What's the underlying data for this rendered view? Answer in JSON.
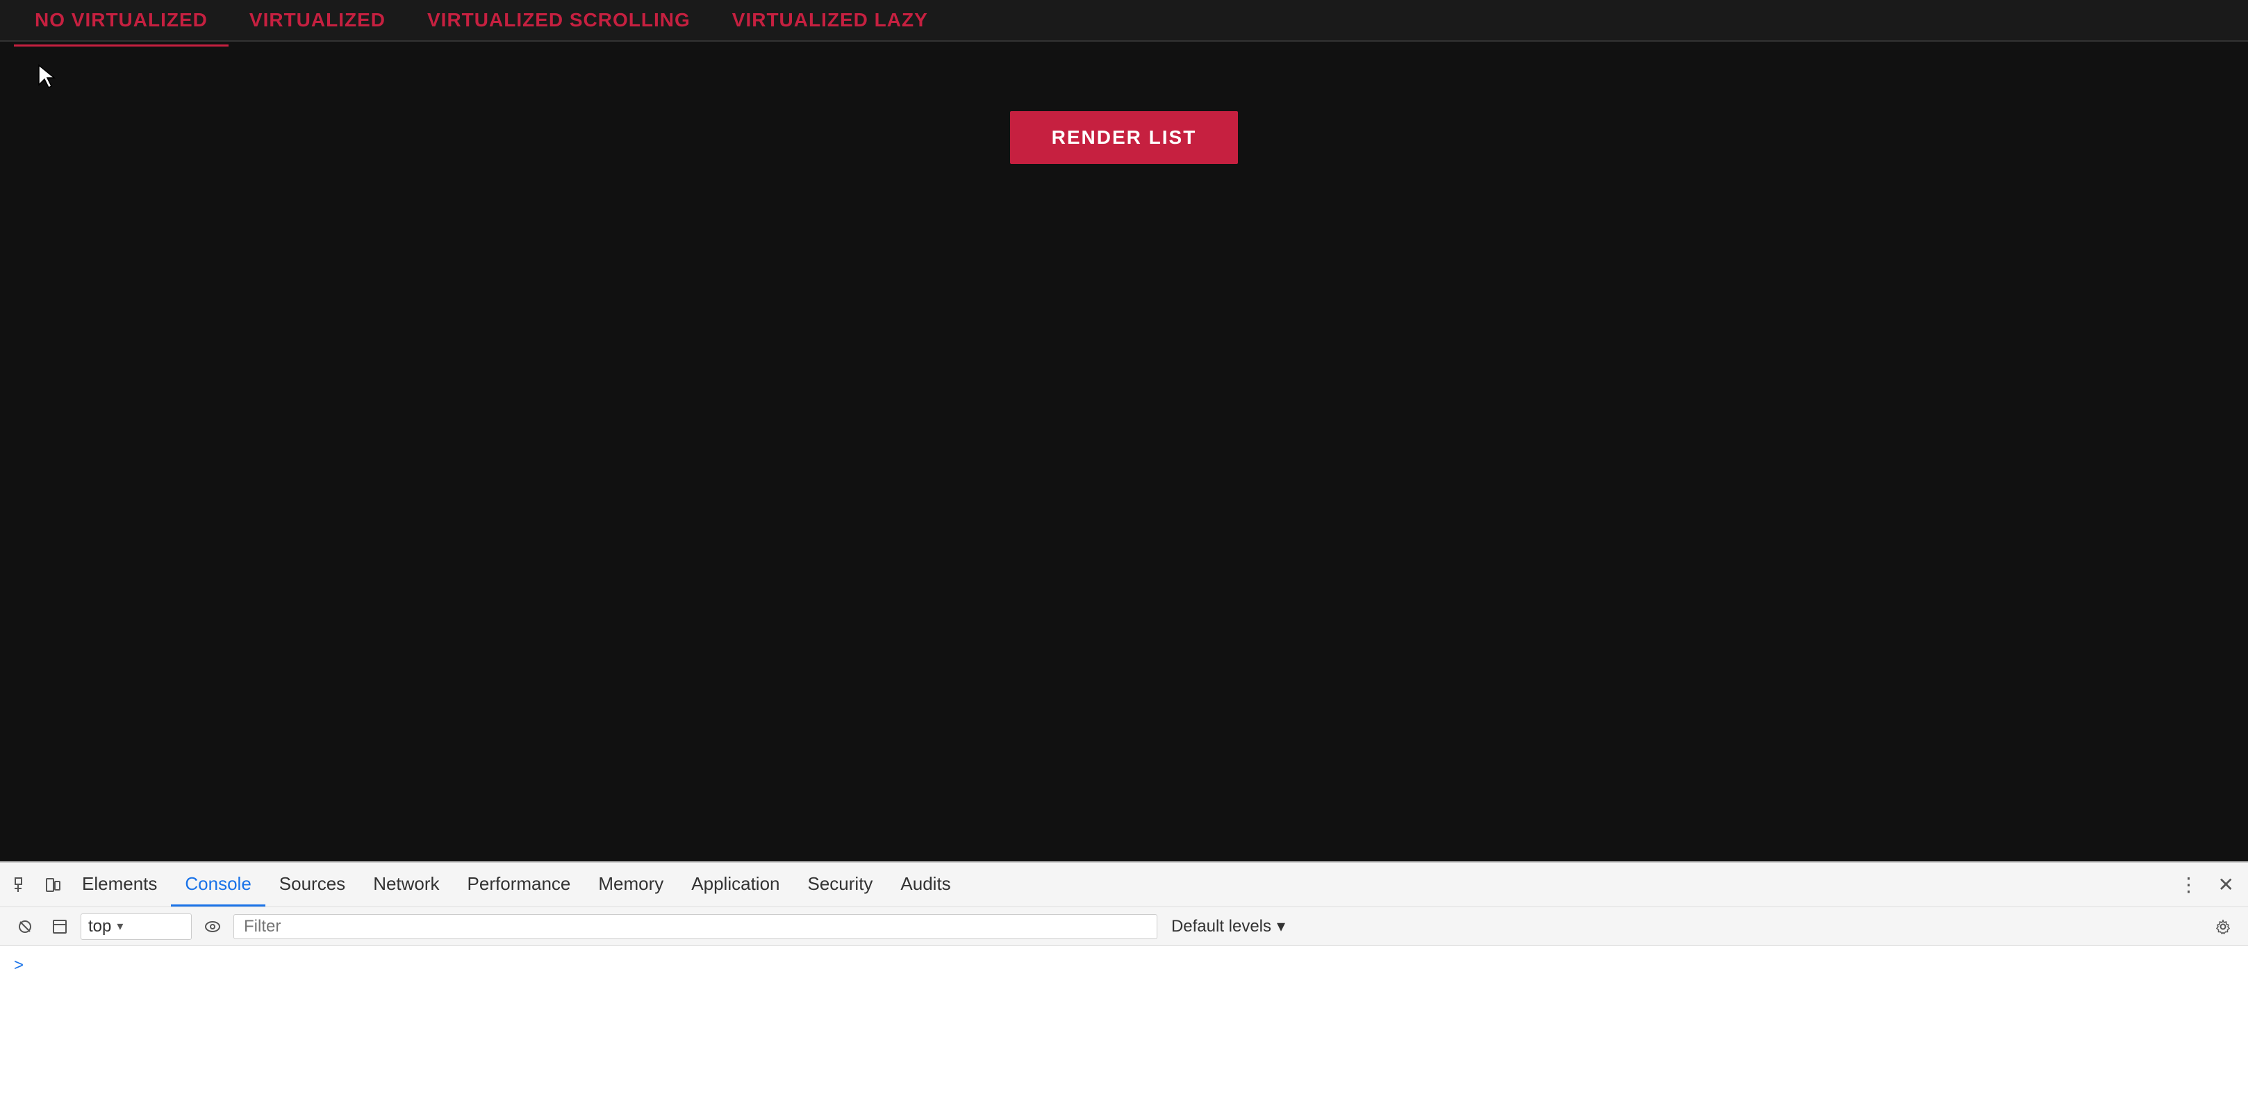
{
  "app": {
    "background": "#111111",
    "tabs": [
      {
        "id": "no-virtualized",
        "label": "NO VIRTUALIZED",
        "active": true
      },
      {
        "id": "virtualized",
        "label": "VIRTUALIZED",
        "active": false
      },
      {
        "id": "virtualized-scrolling",
        "label": "VIRTUALIZED SCROLLING",
        "active": false
      },
      {
        "id": "virtualized-lazy",
        "label": "VIRTUALIZED LAZY",
        "active": false
      }
    ],
    "render_button_label": "RENDER LIST"
  },
  "devtools": {
    "tabs": [
      {
        "id": "elements",
        "label": "Elements",
        "active": false
      },
      {
        "id": "console",
        "label": "Console",
        "active": true
      },
      {
        "id": "sources",
        "label": "Sources",
        "active": false
      },
      {
        "id": "network",
        "label": "Network",
        "active": false
      },
      {
        "id": "performance",
        "label": "Performance",
        "active": false
      },
      {
        "id": "memory",
        "label": "Memory",
        "active": false
      },
      {
        "id": "application",
        "label": "Application",
        "active": false
      },
      {
        "id": "security",
        "label": "Security",
        "active": false
      },
      {
        "id": "audits",
        "label": "Audits",
        "active": false
      }
    ],
    "console_toolbar": {
      "context_label": "top",
      "filter_placeholder": "Filter",
      "default_levels_label": "Default levels"
    },
    "console_output": {
      "caret": ">"
    }
  }
}
